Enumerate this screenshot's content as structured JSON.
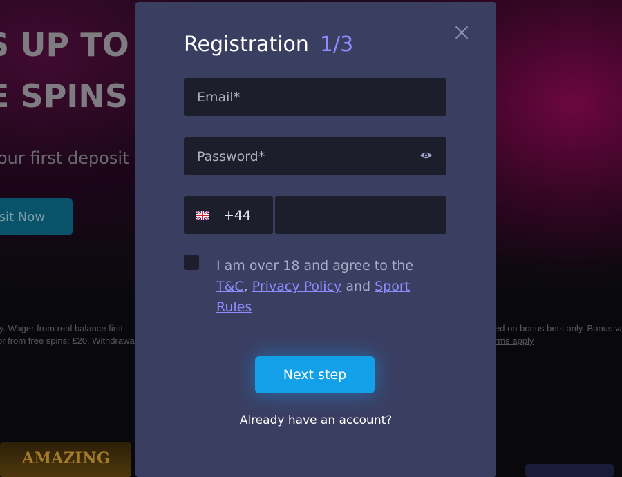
{
  "background": {
    "hero_line_1": "S UP TO £",
    "hero_line_2": "E SPINS",
    "hero_sub": "our first deposit",
    "deposit_button": "sit Now",
    "terms_left_1": "ly. Wager from real balance first.",
    "terms_left_2": "or from free spins: £20. Withdrawa",
    "terms_right_1": "ed on bonus bets only. Bonus va",
    "terms_right_2": "rms apply",
    "game_tile_label": "AMAZING"
  },
  "modal": {
    "title": "Registration",
    "step": "1/3",
    "email_placeholder": "Email*",
    "password_placeholder": "Password*",
    "phone_code": "+44",
    "phone_number_value": "",
    "agree_prefix": "I am over 18 and agree to the",
    "link_tc": "T&C",
    "separator": ",",
    "link_privacy": "Privacy Policy",
    "and_word": "and",
    "link_sport_rules": "Sport Rules",
    "next_button": "Next step",
    "login_link": "Already have an account?"
  },
  "icons": {
    "close": "close-icon",
    "eye": "eye-icon",
    "flag": "uk-flag-icon"
  },
  "colors": {
    "modal_bg": "#3a3f62",
    "field_bg": "#1c1f2b",
    "accent_purple": "#8c8cff",
    "primary_button": "#12a0e8"
  }
}
